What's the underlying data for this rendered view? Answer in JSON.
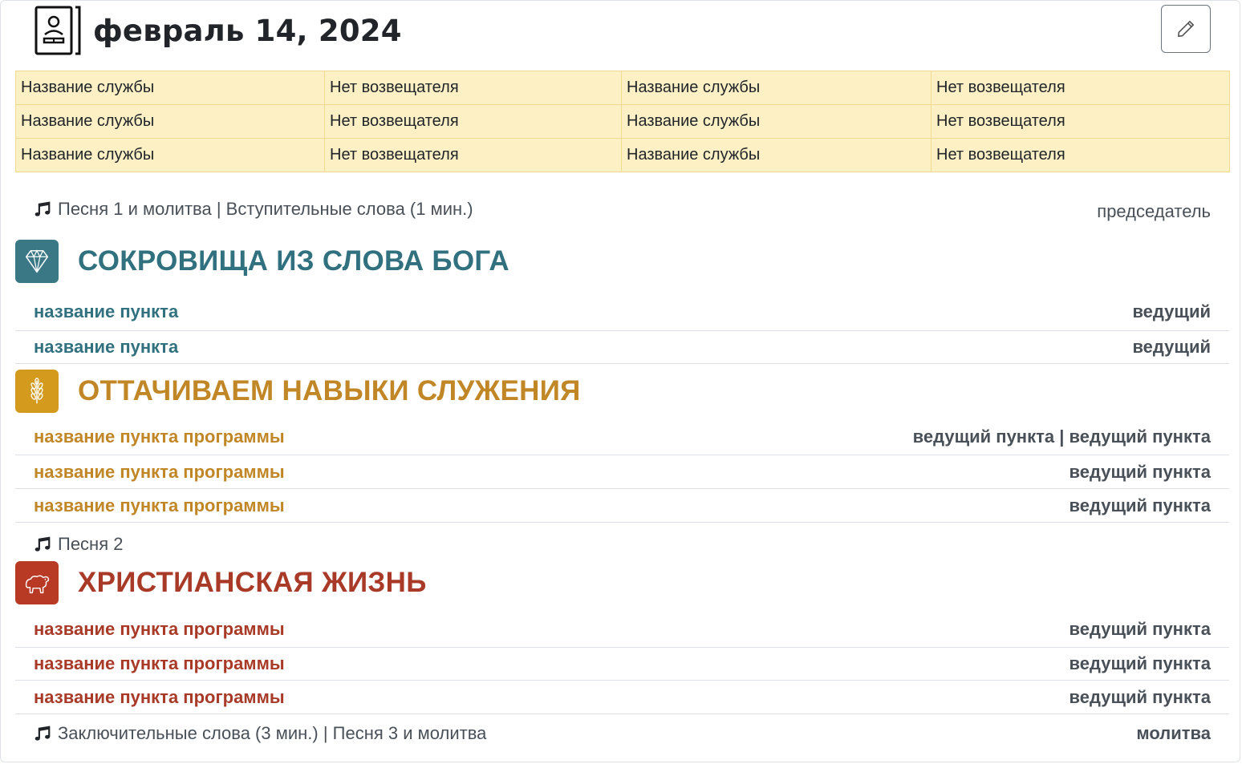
{
  "header": {
    "title": "февраль 14, 2024",
    "icon": "bible-reader-icon",
    "edit_icon": "pencil-icon"
  },
  "duty_table": [
    [
      "Название службы",
      "Нет возвещателя",
      "Название службы",
      "Нет возвещателя"
    ],
    [
      "Название службы",
      "Нет возвещателя",
      "Название службы",
      "Нет возвещателя"
    ],
    [
      "Название службы",
      "Нет возвещателя",
      "Название службы",
      "Нет возвещателя"
    ]
  ],
  "opening": {
    "icon": "music-note-icon",
    "text": "Песня 1 и молитва | Вступительные слова (1 мин.)",
    "assignee": "председатель"
  },
  "sections": [
    {
      "title": "СОКРОВИЩА ИЗ СЛОВА БОГА",
      "icon": "diamond-icon",
      "color": "#31717f",
      "items": [
        {
          "name": "название пункта",
          "assignee": "ведущий"
        },
        {
          "name": "название пункта",
          "assignee": "ведущий"
        }
      ]
    },
    {
      "title": "ОТТАЧИВАЕМ НАВЫКИ СЛУЖЕНИЯ",
      "icon": "wheat-icon",
      "color": "#c18626",
      "items": [
        {
          "name": "название пункта программы",
          "assignee": "ведущий пункта | ведущий пункта"
        },
        {
          "name": "название пункта программы",
          "assignee": "ведущий пункта"
        },
        {
          "name": "название пункта программы",
          "assignee": "ведущий пункта"
        }
      ]
    },
    {
      "title": "ХРИСТИАНСКАЯ ЖИЗНЬ",
      "icon": "sheep-icon",
      "color": "#a83a27",
      "items": [
        {
          "name": "название пункта программы",
          "assignee": "ведущий пункта"
        },
        {
          "name": "название пункта программы",
          "assignee": "ведущий пункта"
        },
        {
          "name": "название пункта программы",
          "assignee": "ведущий пункта"
        }
      ]
    }
  ],
  "middle_song": {
    "icon": "music-note-icon",
    "text": "Песня 2"
  },
  "closing": {
    "icon": "music-note-icon",
    "text": "Заключительные слова (3 мин.) | Песня 3 и молитва",
    "assignee": "молитва"
  }
}
